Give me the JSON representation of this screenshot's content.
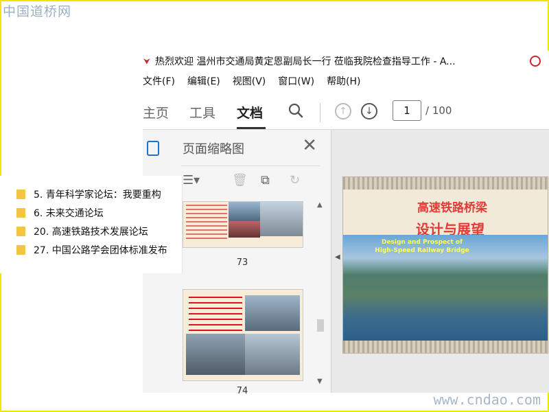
{
  "watermarks": {
    "top_left": "中国道桥网",
    "bottom_right": "www.cndao.com"
  },
  "window": {
    "title": "热烈欢迎 温州市交通局黄定恩副局长一行 莅临我院检查指导工作 - A...",
    "menu": [
      "文件(F)",
      "编辑(E)",
      "视图(V)",
      "窗口(W)",
      "帮助(H)"
    ]
  },
  "toolbar": {
    "tabs": [
      "主页",
      "工具",
      "文档"
    ],
    "active_tab": "文档",
    "page_input_value": "1",
    "page_total": "/ 100"
  },
  "thumbnails_panel": {
    "title": "页面缩略图",
    "pages": [
      "73",
      "74"
    ]
  },
  "slide": {
    "title_line1": "高速铁路桥梁",
    "title_line2": "设计与展望",
    "english_line1": "Design and Prospect of",
    "english_line2": "High-Speed Railway Bridge"
  },
  "bookmarks_popup": {
    "items": [
      "5. 青年科学家论坛：我要重构",
      "6. 未来交通论坛",
      "20. 高速铁路技术发展论坛",
      "27. 中国公路学会团体标准发布"
    ]
  }
}
